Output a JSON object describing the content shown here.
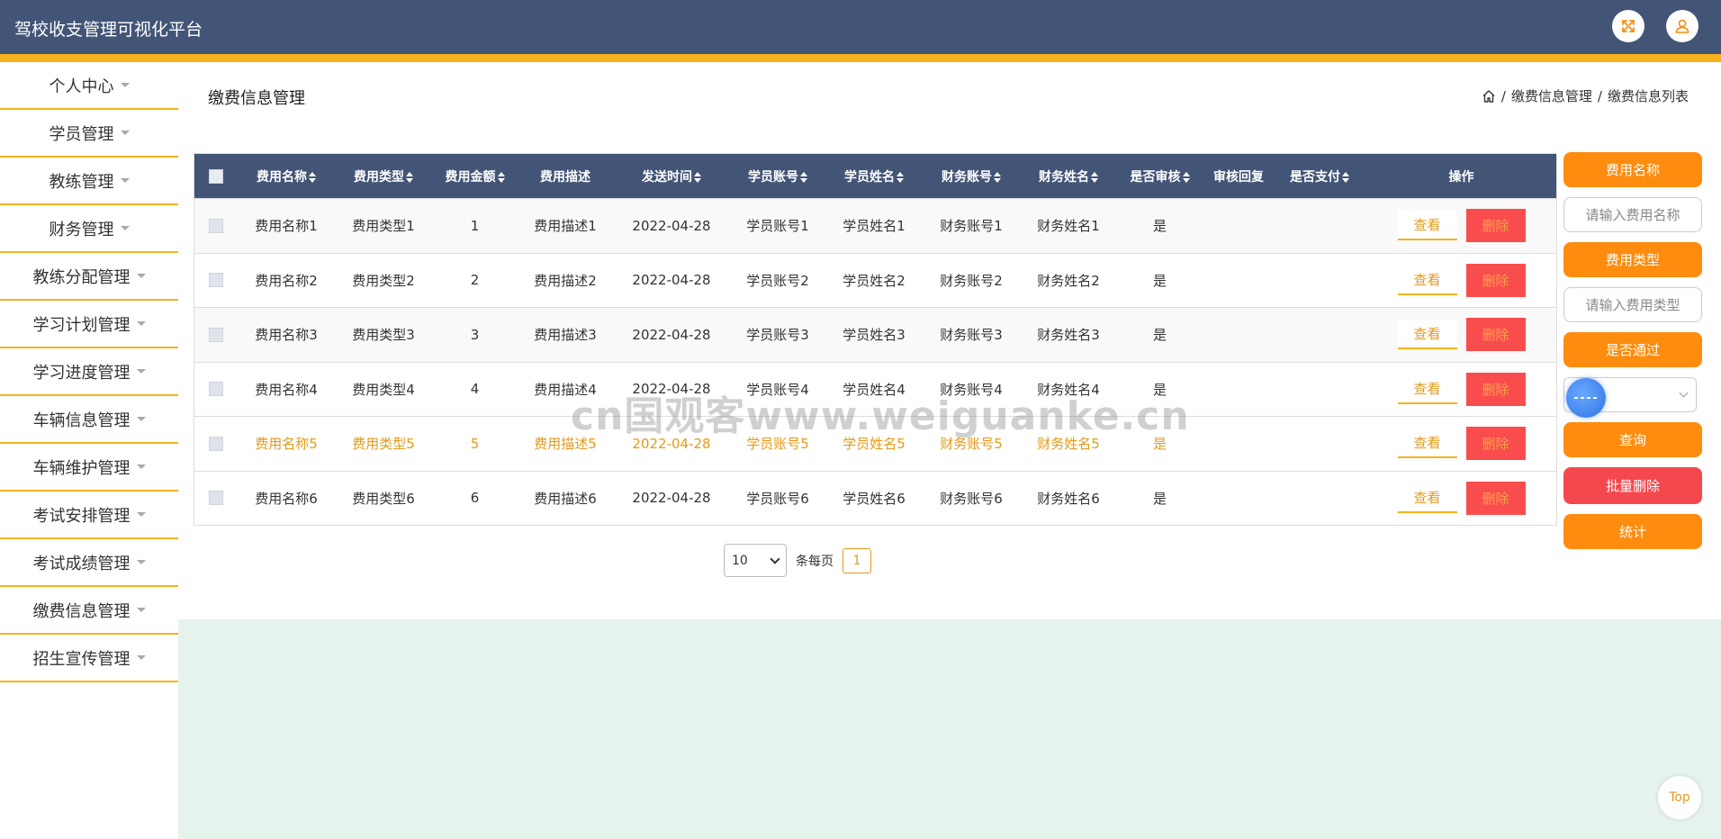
{
  "header": {
    "app_title": "驾校收支管理可视化平台",
    "fullscreen_icon": "fullscreen-icon",
    "user_icon": "user-icon"
  },
  "sidebar": {
    "items": [
      {
        "label": "个人中心"
      },
      {
        "label": "学员管理"
      },
      {
        "label": "教练管理"
      },
      {
        "label": "财务管理"
      },
      {
        "label": "教练分配管理"
      },
      {
        "label": "学习计划管理"
      },
      {
        "label": "学习进度管理"
      },
      {
        "label": "车辆信息管理"
      },
      {
        "label": "车辆维护管理"
      },
      {
        "label": "考试安排管理"
      },
      {
        "label": "考试成绩管理"
      },
      {
        "label": "缴费信息管理"
      },
      {
        "label": "招生宣传管理"
      }
    ]
  },
  "page": {
    "heading": "缴费信息管理",
    "breadcrumb": [
      "缴费信息管理",
      "缴费信息列表"
    ],
    "breadcrumb_sep": "/"
  },
  "table": {
    "headers": {
      "name": "费用名称",
      "type": "费用类型",
      "amount": "费用金额",
      "desc": "费用描述",
      "time": "发送时间",
      "student_acc": "学员账号",
      "student_name": "学员姓名",
      "finance_acc": "财务账号",
      "finance_name": "财务姓名",
      "audit": "是否审核",
      "reply": "审核回复",
      "paid": "是否支付",
      "ops": "操作"
    },
    "view_label": "查看",
    "delete_label": "删除",
    "rows": [
      {
        "name": "费用名称1",
        "type": "费用类型1",
        "amount": "1",
        "desc": "费用描述1",
        "time": "2022-04-28",
        "student_acc": "学员账号1",
        "student_name": "学员姓名1",
        "finance_acc": "财务账号1",
        "finance_name": "财务姓名1",
        "audit": "是",
        "reply": "",
        "paid": ""
      },
      {
        "name": "费用名称2",
        "type": "费用类型2",
        "amount": "2",
        "desc": "费用描述2",
        "time": "2022-04-28",
        "student_acc": "学员账号2",
        "student_name": "学员姓名2",
        "finance_acc": "财务账号2",
        "finance_name": "财务姓名2",
        "audit": "是",
        "reply": "",
        "paid": ""
      },
      {
        "name": "费用名称3",
        "type": "费用类型3",
        "amount": "3",
        "desc": "费用描述3",
        "time": "2022-04-28",
        "student_acc": "学员账号3",
        "student_name": "学员姓名3",
        "finance_acc": "财务账号3",
        "finance_name": "财务姓名3",
        "audit": "是",
        "reply": "",
        "paid": ""
      },
      {
        "name": "费用名称4",
        "type": "费用类型4",
        "amount": "4",
        "desc": "费用描述4",
        "time": "2022-04-28",
        "student_acc": "学员账号4",
        "student_name": "学员姓名4",
        "finance_acc": "财务账号4",
        "finance_name": "财务姓名4",
        "audit": "是",
        "reply": "",
        "paid": ""
      },
      {
        "name": "费用名称5",
        "type": "费用类型5",
        "amount": "5",
        "desc": "费用描述5",
        "time": "2022-04-28",
        "student_acc": "学员账号5",
        "student_name": "学员姓名5",
        "finance_acc": "财务账号5",
        "finance_name": "财务姓名5",
        "audit": "是",
        "reply": "",
        "paid": ""
      },
      {
        "name": "费用名称6",
        "type": "费用类型6",
        "amount": "6",
        "desc": "费用描述6",
        "time": "2022-04-28",
        "student_acc": "学员账号6",
        "student_name": "学员姓名6",
        "finance_acc": "财务账号6",
        "finance_name": "财务姓名6",
        "audit": "是",
        "reply": "",
        "paid": ""
      }
    ],
    "highlight_row": 4
  },
  "pagination": {
    "page_size": "10",
    "per_page_label": "条每页",
    "current_page": "1"
  },
  "filter": {
    "name_label": "费用名称",
    "name_placeholder": "请输入费用名称",
    "type_label": "费用类型",
    "type_placeholder": "请输入费用类型",
    "pass_label": "是否通过",
    "query_label": "查询",
    "batch_delete_label": "批量删除",
    "stats_label": "统计"
  },
  "watermark": "cn国观客www.weiguanke.cn",
  "top_button": "Top",
  "colors": {
    "header": "#435577",
    "accent": "#f7b21d",
    "orange_button": "#fd8c0f",
    "danger": "#f5484e",
    "highlight_text": "#e49a1a",
    "footer_bg": "#e6f3ec"
  }
}
